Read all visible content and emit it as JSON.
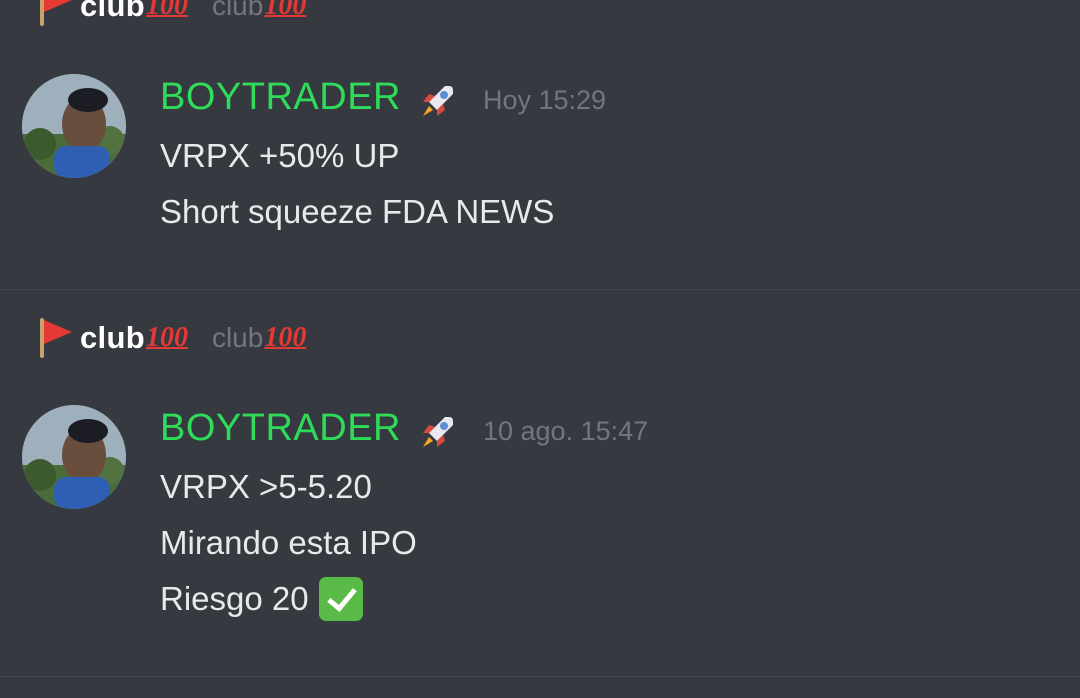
{
  "server": {
    "name": "club",
    "hundred_emoji": "100",
    "subname": "club",
    "flag_icon": "red-flag-icon"
  },
  "messages": [
    {
      "username": "BOYTRADER",
      "badge_icon": "rocket-icon",
      "timestamp": "Hoy 15:29",
      "lines": [
        "VRPX +50% UP",
        "Short squeeze FDA NEWS"
      ]
    },
    {
      "username": "BOYTRADER",
      "badge_icon": "rocket-icon",
      "timestamp": "10 ago. 15:47",
      "lines": [
        "VRPX >5-5.20",
        "Mirando esta IPO",
        "Riesgo 20"
      ],
      "trailing_icon": "check-mark-icon"
    }
  ],
  "colors": {
    "background": "#36393f",
    "username": "#2edc5a",
    "timestamp": "#72767d",
    "text": "#e8e9ea",
    "hundred": "#e53935"
  }
}
